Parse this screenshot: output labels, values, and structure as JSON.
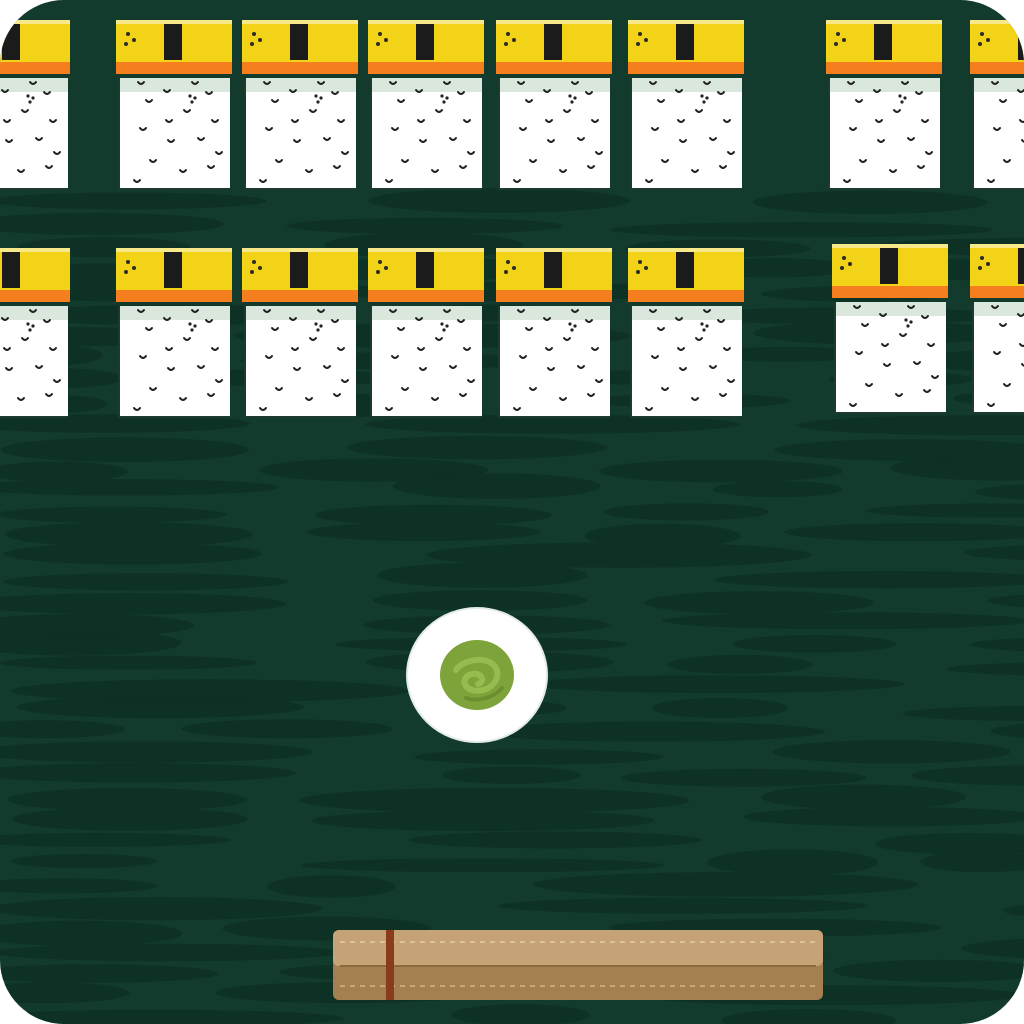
{
  "game": {
    "title": "",
    "colors": {
      "board": "#123a2d",
      "board_streak": "#0e3024",
      "rice": "#ffffff",
      "rice_shadow": "#d9e7dc",
      "rice_grain": "#222222",
      "egg": "#f2d318",
      "egg_edge": "#f57f1f",
      "nori": "#1b1b1b",
      "wasabi": "#7da33a",
      "wasabi_bowl": "#ffffff",
      "paddle": "#c6a277",
      "paddle_shade": "#a47f50",
      "paddle_band": "#8a3b1c"
    },
    "brick_rows": 2,
    "bricks_per_row": 8,
    "brick_style": "tamago-nigiri-icon",
    "ball_style": "wasabi-bowl-icon",
    "paddle_style": "bamboo-mat-icon"
  }
}
